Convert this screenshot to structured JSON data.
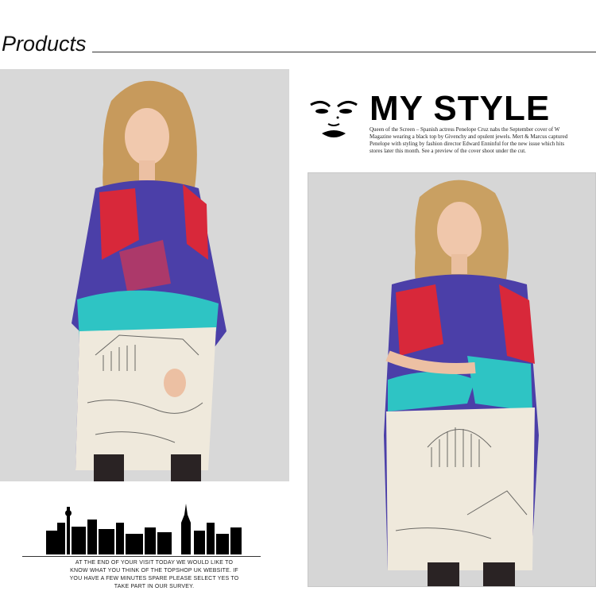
{
  "header": {
    "title": "Products"
  },
  "mystyle": {
    "title": "MY STYLE",
    "caption": "Queen of the Screen – Spanish actress Penelope Cruz nabs the September cover of W Magazine wearing a black top by Givenchy and opulent jewels. Mert & Marcus captured Penelope with styling by fashion director Edward Enninful for the new issue which hits stores later this month. See a preview of the cover shoot under the cut."
  },
  "footer": {
    "text": "AT THE END OF YOUR VISIT TODAY WE WOULD LIKE TO KNOW WHAT YOU THINK OF THE TOPSHOP UK WEBSITE. IF YOU HAVE A FEW MINUTES SPARE PLEASE SELECT YES TO TAKE PART IN OUR SURVEY."
  },
  "colors": {
    "background": "#ffffff",
    "photo_bg": "#d9d9d9",
    "dress_purple": "#4b3fa8",
    "dress_red": "#d8283a",
    "dress_teal": "#2ec4c4",
    "dress_cream": "#efe9dc"
  },
  "icons": [
    "woman-face-icon",
    "city-skyline-icon"
  ]
}
